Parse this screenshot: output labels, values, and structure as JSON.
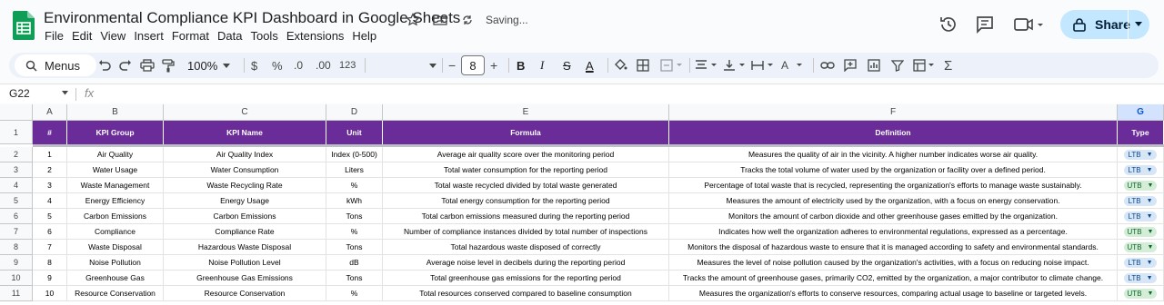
{
  "app": {
    "title": "Environmental Compliance KPI Dashboard in Google Sheets",
    "status": "Saving...",
    "share_label": "Share",
    "menu": [
      "File",
      "Edit",
      "View",
      "Insert",
      "Format",
      "Data",
      "Tools",
      "Extensions",
      "Help"
    ]
  },
  "toolbar": {
    "menus_label": "Menus",
    "zoom": "100%",
    "currency": "$",
    "percent": "%",
    "dec_decrease": ".0",
    "dec_increase": ".00",
    "number_format": "123",
    "font_size": "8",
    "minus": "−",
    "plus": "+",
    "bold": "B",
    "italic": "I",
    "strike": "S",
    "text_color": "A"
  },
  "formula_bar": {
    "name_box": "G22",
    "fx": "fx"
  },
  "columns": [
    "A",
    "B",
    "C",
    "D",
    "E",
    "F",
    "G"
  ],
  "header": [
    "#",
    "KPI Group",
    "KPI Name",
    "Unit",
    "Formula",
    "Definition",
    "Type"
  ],
  "rows": [
    {
      "n": "1",
      "group": "Air Quality",
      "name": "Air Quality Index",
      "unit": "Index (0-500)",
      "formula": "Average air quality score over the monitoring period",
      "definition": "Measures the quality of air in the vicinity. A higher number indicates worse air quality.",
      "type": "LTB"
    },
    {
      "n": "2",
      "group": "Water Usage",
      "name": "Water Consumption",
      "unit": "Liters",
      "formula": "Total water consumption for the reporting period",
      "definition": "Tracks the total volume of water used by the organization or facility over a defined period.",
      "type": "LTB"
    },
    {
      "n": "3",
      "group": "Waste Management",
      "name": "Waste Recycling Rate",
      "unit": "%",
      "formula": "Total waste recycled divided by total waste generated",
      "definition": "Percentage of total waste that is recycled, representing the organization's efforts to manage waste sustainably.",
      "type": "UTB"
    },
    {
      "n": "4",
      "group": "Energy Efficiency",
      "name": "Energy Usage",
      "unit": "kWh",
      "formula": "Total energy consumption for the reporting period",
      "definition": "Measures the amount of electricity used by the organization, with a focus on energy conservation.",
      "type": "LTB"
    },
    {
      "n": "5",
      "group": "Carbon Emissions",
      "name": "Carbon Emissions",
      "unit": "Tons",
      "formula": "Total carbon emissions measured during the reporting period",
      "definition": "Monitors the amount of carbon dioxide and other greenhouse gases emitted by the organization.",
      "type": "LTB"
    },
    {
      "n": "6",
      "group": "Compliance",
      "name": "Compliance Rate",
      "unit": "%",
      "formula": "Number of compliance instances divided by total number of inspections",
      "definition": "Indicates how well the organization adheres to environmental regulations, expressed as a percentage.",
      "type": "UTB"
    },
    {
      "n": "7",
      "group": "Waste Disposal",
      "name": "Hazardous Waste Disposal",
      "unit": "Tons",
      "formula": "Total hazardous waste disposed of correctly",
      "definition": "Monitors the disposal of hazardous waste to ensure that it is managed according to safety and environmental standards.",
      "type": "UTB"
    },
    {
      "n": "8",
      "group": "Noise Pollution",
      "name": "Noise Pollution Level",
      "unit": "dB",
      "formula": "Average noise level in decibels during the reporting period",
      "definition": "Measures the level of noise pollution caused by the organization's activities, with a focus on reducing noise impact.",
      "type": "LTB"
    },
    {
      "n": "9",
      "group": "Greenhouse Gas",
      "name": "Greenhouse Gas Emissions",
      "unit": "Tons",
      "formula": "Total greenhouse gas emissions for the reporting period",
      "definition": "Tracks the amount of greenhouse gases, primarily CO2, emitted by the organization, a major contributor to climate change.",
      "type": "LTB"
    },
    {
      "n": "10",
      "group": "Resource Conservation",
      "name": "Resource Conservation",
      "unit": "%",
      "formula": "Total resources conserved compared to baseline consumption",
      "definition": "Measures the organization's efforts to conserve resources, comparing actual usage to baseline or targeted levels.",
      "type": "UTB"
    }
  ],
  "colors": {
    "header_bg": "#6a2c99",
    "ltb_chip": "#d7e6f7",
    "utb_chip": "#d4edd6",
    "share_bg": "#c2e7ff"
  }
}
